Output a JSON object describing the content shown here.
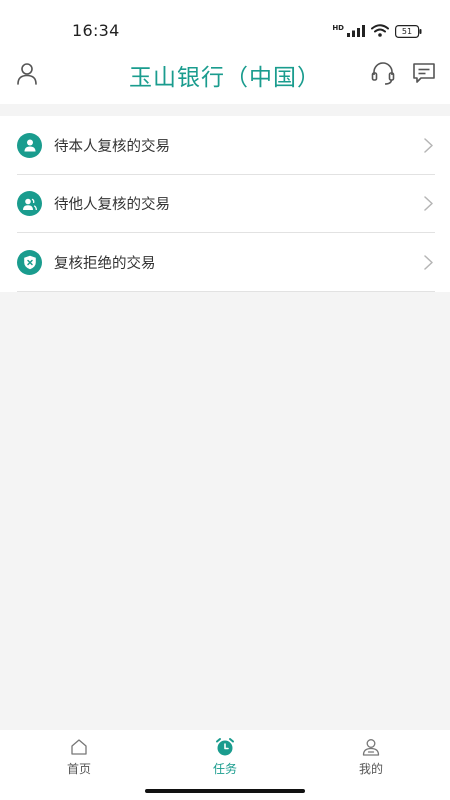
{
  "status_bar": {
    "time": "16:34",
    "network": "HD",
    "battery": "51",
    "icons": [
      "signal-icon",
      "wifi-icon",
      "battery-icon"
    ]
  },
  "header": {
    "title": "玉山银行（中国）",
    "left_icon": "user-icon",
    "right_icons": [
      "headset-icon",
      "message-icon"
    ]
  },
  "review_list": {
    "items": [
      {
        "label": "待本人复核的交易",
        "icon": "person-icon"
      },
      {
        "label": "待他人复核的交易",
        "icon": "people-icon"
      },
      {
        "label": "复核拒绝的交易",
        "icon": "shield-x-icon"
      }
    ]
  },
  "tab_bar": {
    "active": "任务",
    "tabs": [
      {
        "label": "首页",
        "icon": "home-icon"
      },
      {
        "label": "任务",
        "icon": "alarm-clock-icon"
      },
      {
        "label": "我的",
        "icon": "profile-icon"
      }
    ]
  },
  "colors": {
    "accent": "#1a9c8e",
    "background": "#f4f4f4",
    "surface": "#ffffff",
    "divider": "#e2e2e2",
    "text": "#333333"
  }
}
